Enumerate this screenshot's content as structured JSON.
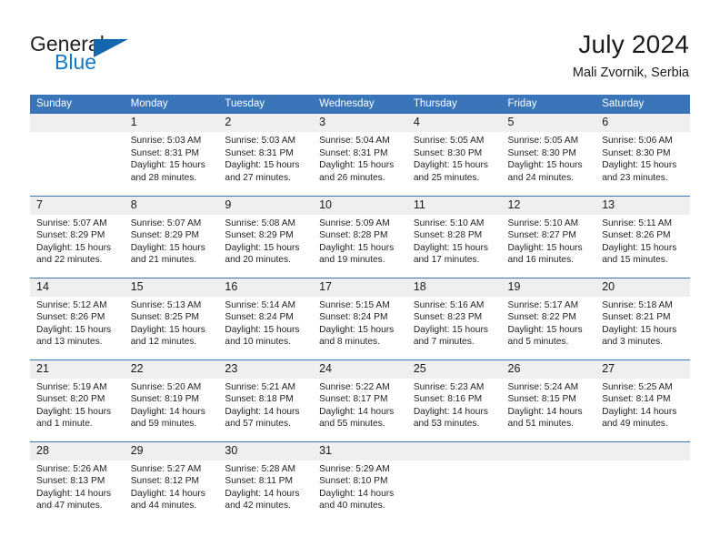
{
  "brand": {
    "name_part1": "General",
    "name_part2": "Blue",
    "flag_icon": "triangle-flag-icon"
  },
  "header": {
    "title": "July 2024",
    "subtitle": "Mali Zvornik, Serbia"
  },
  "colors": {
    "header_blue": "#3a75ba",
    "brand_blue": "#1277c7",
    "daynum_background": "#efefef",
    "text": "#1a1a1a"
  },
  "weekday_headers": [
    "Sunday",
    "Monday",
    "Tuesday",
    "Wednesday",
    "Thursday",
    "Friday",
    "Saturday"
  ],
  "labels": {
    "sunrise_prefix": "Sunrise:",
    "sunset_prefix": "Sunset:",
    "daylight_prefix": "Daylight:"
  },
  "weeks": [
    [
      {
        "day": "",
        "lines": []
      },
      {
        "day": "1",
        "lines": [
          "Sunrise: 5:03 AM",
          "Sunset: 8:31 PM",
          "Daylight: 15 hours",
          "and 28 minutes."
        ]
      },
      {
        "day": "2",
        "lines": [
          "Sunrise: 5:03 AM",
          "Sunset: 8:31 PM",
          "Daylight: 15 hours",
          "and 27 minutes."
        ]
      },
      {
        "day": "3",
        "lines": [
          "Sunrise: 5:04 AM",
          "Sunset: 8:31 PM",
          "Daylight: 15 hours",
          "and 26 minutes."
        ]
      },
      {
        "day": "4",
        "lines": [
          "Sunrise: 5:05 AM",
          "Sunset: 8:30 PM",
          "Daylight: 15 hours",
          "and 25 minutes."
        ]
      },
      {
        "day": "5",
        "lines": [
          "Sunrise: 5:05 AM",
          "Sunset: 8:30 PM",
          "Daylight: 15 hours",
          "and 24 minutes."
        ]
      },
      {
        "day": "6",
        "lines": [
          "Sunrise: 5:06 AM",
          "Sunset: 8:30 PM",
          "Daylight: 15 hours",
          "and 23 minutes."
        ]
      }
    ],
    [
      {
        "day": "7",
        "lines": [
          "Sunrise: 5:07 AM",
          "Sunset: 8:29 PM",
          "Daylight: 15 hours",
          "and 22 minutes."
        ]
      },
      {
        "day": "8",
        "lines": [
          "Sunrise: 5:07 AM",
          "Sunset: 8:29 PM",
          "Daylight: 15 hours",
          "and 21 minutes."
        ]
      },
      {
        "day": "9",
        "lines": [
          "Sunrise: 5:08 AM",
          "Sunset: 8:29 PM",
          "Daylight: 15 hours",
          "and 20 minutes."
        ]
      },
      {
        "day": "10",
        "lines": [
          "Sunrise: 5:09 AM",
          "Sunset: 8:28 PM",
          "Daylight: 15 hours",
          "and 19 minutes."
        ]
      },
      {
        "day": "11",
        "lines": [
          "Sunrise: 5:10 AM",
          "Sunset: 8:28 PM",
          "Daylight: 15 hours",
          "and 17 minutes."
        ]
      },
      {
        "day": "12",
        "lines": [
          "Sunrise: 5:10 AM",
          "Sunset: 8:27 PM",
          "Daylight: 15 hours",
          "and 16 minutes."
        ]
      },
      {
        "day": "13",
        "lines": [
          "Sunrise: 5:11 AM",
          "Sunset: 8:26 PM",
          "Daylight: 15 hours",
          "and 15 minutes."
        ]
      }
    ],
    [
      {
        "day": "14",
        "lines": [
          "Sunrise: 5:12 AM",
          "Sunset: 8:26 PM",
          "Daylight: 15 hours",
          "and 13 minutes."
        ]
      },
      {
        "day": "15",
        "lines": [
          "Sunrise: 5:13 AM",
          "Sunset: 8:25 PM",
          "Daylight: 15 hours",
          "and 12 minutes."
        ]
      },
      {
        "day": "16",
        "lines": [
          "Sunrise: 5:14 AM",
          "Sunset: 8:24 PM",
          "Daylight: 15 hours",
          "and 10 minutes."
        ]
      },
      {
        "day": "17",
        "lines": [
          "Sunrise: 5:15 AM",
          "Sunset: 8:24 PM",
          "Daylight: 15 hours",
          "and 8 minutes."
        ]
      },
      {
        "day": "18",
        "lines": [
          "Sunrise: 5:16 AM",
          "Sunset: 8:23 PM",
          "Daylight: 15 hours",
          "and 7 minutes."
        ]
      },
      {
        "day": "19",
        "lines": [
          "Sunrise: 5:17 AM",
          "Sunset: 8:22 PM",
          "Daylight: 15 hours",
          "and 5 minutes."
        ]
      },
      {
        "day": "20",
        "lines": [
          "Sunrise: 5:18 AM",
          "Sunset: 8:21 PM",
          "Daylight: 15 hours",
          "and 3 minutes."
        ]
      }
    ],
    [
      {
        "day": "21",
        "lines": [
          "Sunrise: 5:19 AM",
          "Sunset: 8:20 PM",
          "Daylight: 15 hours",
          "and 1 minute."
        ]
      },
      {
        "day": "22",
        "lines": [
          "Sunrise: 5:20 AM",
          "Sunset: 8:19 PM",
          "Daylight: 14 hours",
          "and 59 minutes."
        ]
      },
      {
        "day": "23",
        "lines": [
          "Sunrise: 5:21 AM",
          "Sunset: 8:18 PM",
          "Daylight: 14 hours",
          "and 57 minutes."
        ]
      },
      {
        "day": "24",
        "lines": [
          "Sunrise: 5:22 AM",
          "Sunset: 8:17 PM",
          "Daylight: 14 hours",
          "and 55 minutes."
        ]
      },
      {
        "day": "25",
        "lines": [
          "Sunrise: 5:23 AM",
          "Sunset: 8:16 PM",
          "Daylight: 14 hours",
          "and 53 minutes."
        ]
      },
      {
        "day": "26",
        "lines": [
          "Sunrise: 5:24 AM",
          "Sunset: 8:15 PM",
          "Daylight: 14 hours",
          "and 51 minutes."
        ]
      },
      {
        "day": "27",
        "lines": [
          "Sunrise: 5:25 AM",
          "Sunset: 8:14 PM",
          "Daylight: 14 hours",
          "and 49 minutes."
        ]
      }
    ],
    [
      {
        "day": "28",
        "lines": [
          "Sunrise: 5:26 AM",
          "Sunset: 8:13 PM",
          "Daylight: 14 hours",
          "and 47 minutes."
        ]
      },
      {
        "day": "29",
        "lines": [
          "Sunrise: 5:27 AM",
          "Sunset: 8:12 PM",
          "Daylight: 14 hours",
          "and 44 minutes."
        ]
      },
      {
        "day": "30",
        "lines": [
          "Sunrise: 5:28 AM",
          "Sunset: 8:11 PM",
          "Daylight: 14 hours",
          "and 42 minutes."
        ]
      },
      {
        "day": "31",
        "lines": [
          "Sunrise: 5:29 AM",
          "Sunset: 8:10 PM",
          "Daylight: 14 hours",
          "and 40 minutes."
        ]
      },
      {
        "day": "",
        "lines": []
      },
      {
        "day": "",
        "lines": []
      },
      {
        "day": "",
        "lines": []
      }
    ]
  ]
}
